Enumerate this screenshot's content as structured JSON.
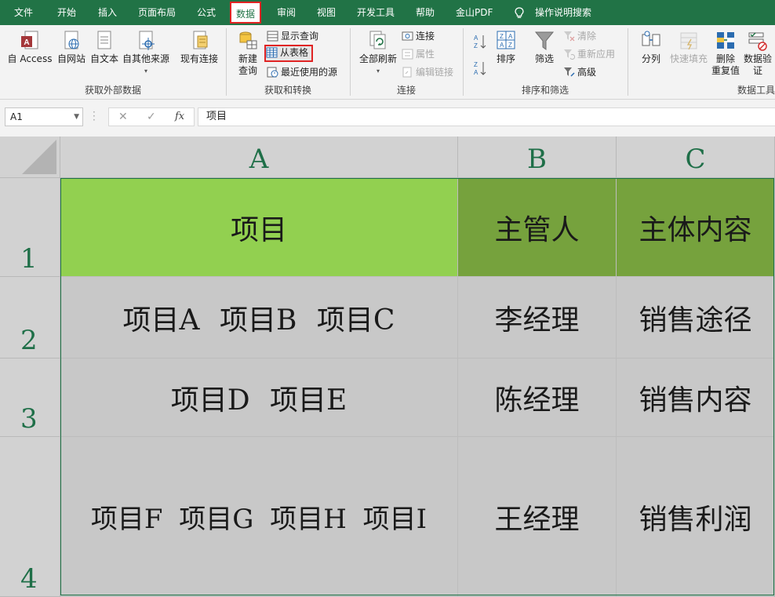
{
  "menu": {
    "tabs": [
      "文件",
      "开始",
      "插入",
      "页面布局",
      "公式",
      "数据",
      "审阅",
      "视图",
      "开发工具",
      "帮助",
      "金山PDF"
    ],
    "active_tab": "数据",
    "search_label": "操作说明搜索"
  },
  "ribbon": {
    "external": {
      "access": "自 Access",
      "web": "自网站",
      "text": "自文本",
      "other": "自其他来源",
      "existing": "现有连接",
      "group": "获取外部数据"
    },
    "transform": {
      "new_query_line1": "新建",
      "new_query_line2": "查询",
      "show_queries": "显示查询",
      "from_table": "从表格",
      "recent_sources": "最近使用的源",
      "group": "获取和转换"
    },
    "connections": {
      "refresh_all": "全部刷新",
      "connections": "连接",
      "properties": "属性",
      "edit_links": "编辑链接",
      "group": "连接"
    },
    "sort_filter": {
      "sort": "排序",
      "filter": "筛选",
      "clear": "清除",
      "reapply": "重新应用",
      "advanced": "高级",
      "group": "排序和筛选"
    },
    "data_tools": {
      "split": "分列",
      "flash_fill": "快速填充",
      "remove_dup_line1": "删除",
      "remove_dup_line2": "重复值",
      "validate_line1": "数据验",
      "validate_line2": "证",
      "group": "数据工具"
    }
  },
  "formula_bar": {
    "name_box": "A1",
    "cancel": "✕",
    "enter": "✓",
    "fx": "fx",
    "content": "项目"
  },
  "sheet": {
    "columns": [
      "A",
      "B",
      "C"
    ],
    "rows": [
      "1",
      "2",
      "3",
      "4"
    ],
    "cells": [
      [
        "项目",
        "主管人",
        "主体内容"
      ],
      [
        "项目A 项目B 项目C",
        "李经理",
        "销售途径"
      ],
      [
        "项目D 项目E",
        "陈经理",
        "销售内容"
      ],
      [
        "项目F 项目G 项目H 项目I",
        "王经理",
        "销售利润"
      ]
    ]
  },
  "colors": {
    "brand": "#217346",
    "highlight": "#e02424",
    "header_green_light": "#92d050",
    "header_green_dark": "#76a23d",
    "cell_gray": "#c8c8c8"
  }
}
